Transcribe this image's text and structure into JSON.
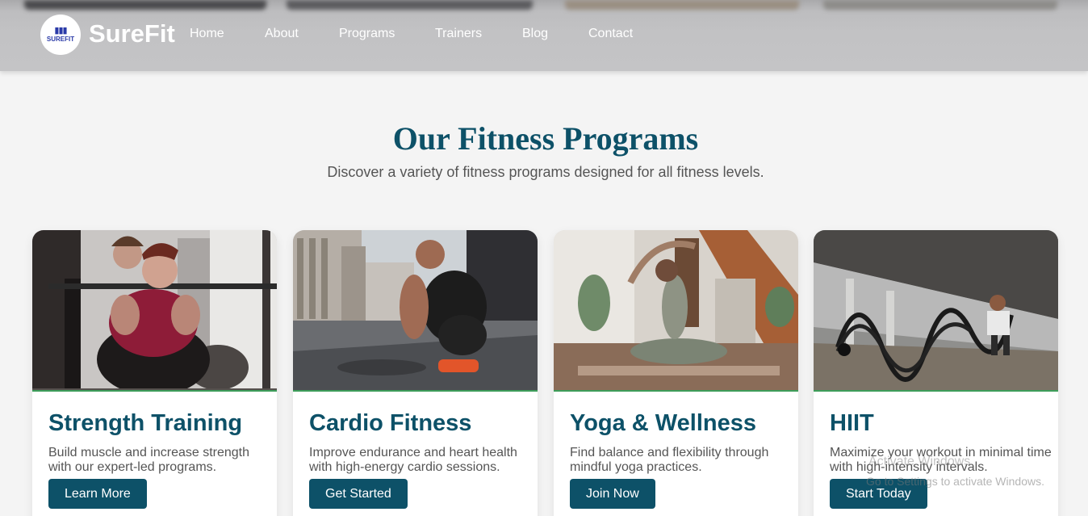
{
  "brand": {
    "logo_text": "SUREFIT",
    "name": "SureFit"
  },
  "nav": [
    "Home",
    "About",
    "Programs",
    "Trainers",
    "Blog",
    "Contact"
  ],
  "section": {
    "title": "Our Fitness Programs",
    "subtitle": "Discover a variety of fitness programs designed for all fitness levels."
  },
  "programs": [
    {
      "title": "Strength Training",
      "description": "Build muscle and increase strength with our expert-led programs.",
      "button": "Learn More",
      "image": "strength-training-photo"
    },
    {
      "title": "Cardio Fitness",
      "description": "Improve endurance and heart health with high-energy cardio sessions.",
      "button": "Get Started",
      "image": "cardio-fitness-photo"
    },
    {
      "title": "Yoga & Wellness",
      "description": "Find balance and flexibility through mindful yoga practices.",
      "button": "Join Now",
      "image": "yoga-wellness-photo"
    },
    {
      "title": "HIIT",
      "description": "Maximize your workout in minimal time with high-intensity intervals.",
      "button": "Start Today",
      "image": "hiit-photo"
    }
  ],
  "watermark": {
    "line1": "Activate Windows",
    "line2": "Go to Settings to activate Windows."
  },
  "colors": {
    "primary": "#0d5168",
    "accent_rule": "#3d9d5a",
    "header_bg": "#c4c4c6",
    "page_bg": "#f4f4f4"
  }
}
